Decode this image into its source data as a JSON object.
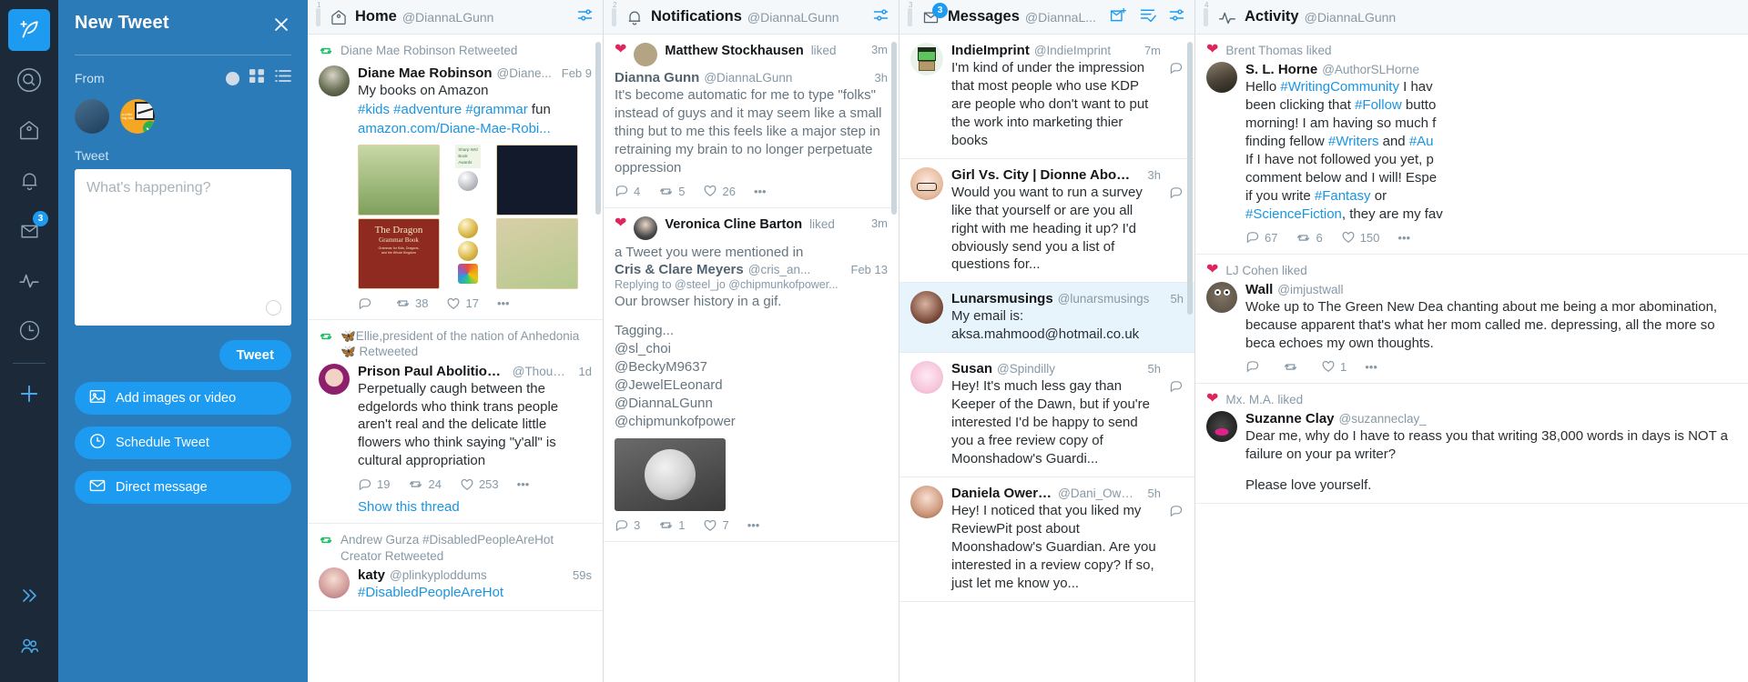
{
  "rail": {
    "items": [
      {
        "name": "compose-tweet",
        "icon": "feather-plus-icon",
        "active": true,
        "badge": ""
      },
      {
        "name": "search",
        "icon": "search-icon",
        "active": false,
        "badge": ""
      },
      {
        "name": "home",
        "icon": "home-icon",
        "active": false,
        "badge": ""
      },
      {
        "name": "notifications",
        "icon": "bell-icon",
        "active": false,
        "badge": ""
      },
      {
        "name": "messages",
        "icon": "envelope-icon",
        "active": false,
        "badge": "3"
      },
      {
        "name": "activity",
        "icon": "activity-pulse-icon",
        "active": false,
        "badge": ""
      },
      {
        "name": "scheduled",
        "icon": "clock-icon",
        "active": false,
        "badge": ""
      },
      {
        "name": "add-column",
        "icon": "plus-icon",
        "active": false,
        "badge": ""
      }
    ],
    "bottom": [
      {
        "name": "collapse-sidebar",
        "icon": "chevron-double-right-icon"
      },
      {
        "name": "accounts",
        "icon": "people-icon"
      }
    ]
  },
  "compose": {
    "title": "New Tweet",
    "close_label": "×",
    "from_label": "From",
    "tweet_label": "Tweet",
    "placeholder": "What's happening?",
    "tweet_button": "Tweet",
    "actions": [
      {
        "label": "Add images or video",
        "icon": "image-icon"
      },
      {
        "label": "Schedule Tweet",
        "icon": "clock-icon"
      },
      {
        "label": "Direct message",
        "icon": "envelope-icon"
      }
    ],
    "accent": "#1d9bf0",
    "panel_bg": "#2b7bb9"
  },
  "columns": [
    {
      "num": "1",
      "title": "Home",
      "handle": "@DiannaLGunn",
      "icon": "home-icon",
      "badge": "",
      "actions": [
        "column-options-icon"
      ],
      "items": [
        {
          "context": "Diane Mae Robinson Retweeted",
          "context_icon": "retweet-icon",
          "name": "Diane Mae Robinson",
          "handle": "@Diane...",
          "time": "Feb 9",
          "avatar": "a-diane",
          "text": "My books on Amazon",
          "link_text": "#kids #adventure #grammar",
          "text_tail": " fun",
          "url": "amazon.com/Diane-Mae-Robi...",
          "media": "book-grid",
          "reply": "",
          "retweet": "38",
          "like": "17",
          "more": "•••"
        },
        {
          "context": "🦋Ellie,president of the nation of Anhedonia 🦋 Retweeted",
          "context_icon": "retweet-icon",
          "name": "Prison Paul Abolitionist",
          "handle": "@Thoug...",
          "time": "1d",
          "avatar": "a-paul",
          "text": "Perpetually caugh between the edgelords who think trans people aren't real and the delicate little flowers who think saying \"y'all\" is cultural appropriation",
          "reply": "19",
          "retweet": "24",
          "like": "253",
          "more": "•••",
          "thread_link": "Show this thread"
        },
        {
          "context": "Andrew Gurza #DisabledPeopleAreHot Creator Retweeted",
          "context_icon": "retweet-icon",
          "name": "katy",
          "handle": "@plinkyploddums",
          "time": "59s",
          "avatar": "a-katy",
          "link_text": "#DisabledPeopleAreHot"
        }
      ]
    },
    {
      "num": "2",
      "title": "Notifications",
      "handle": "@DiannaLGunn",
      "icon": "bell-icon",
      "badge": "",
      "actions": [
        "column-options-icon"
      ],
      "items": [
        {
          "context": "Matthew Stockhausen",
          "context_verb": "liked",
          "context_icon": "heart-icon",
          "context_time": "3m",
          "avatar": "a-matt",
          "name": "Dianna Gunn",
          "handle": "@DiannaLGunn",
          "time": "3h",
          "text": "It's become automatic for me to type \"folks\" instead of guys and it may seem like a small thing but to me this feels like a major step in retraining my brain to no longer perpetuate oppression",
          "reply": "4",
          "retweet": "5",
          "like": "26",
          "more": "•••"
        },
        {
          "context": "Veronica Cline Barton",
          "context_verb": "liked",
          "context_icon": "heart-icon",
          "context_time": "3m",
          "avatar": "a-vero",
          "context_line2": "a Tweet you were mentioned in",
          "name": "Cris & Clare Meyers",
          "handle": "@cris_an...",
          "time": "Feb 13",
          "replying_to": "Replying to @steel_jo @chipmunkofpower...",
          "text": "Our browser history in a gif.",
          "text2": "Tagging...\n@sl_choi\n@BeckyM9637\n@JewelELeonard\n@DiannaLGunn\n@chipmunkofpower",
          "media": "cat-photo",
          "reply": "3",
          "retweet": "1",
          "like": "7",
          "more": "•••"
        }
      ]
    },
    {
      "num": "3",
      "title": "Messages",
      "handle": "@DiannaL...",
      "icon": "envelope-icon",
      "badge": "3",
      "actions": [
        "new-message-icon",
        "mark-all-read-icon",
        "column-options-icon"
      ],
      "items": [
        {
          "name": "IndieImprint",
          "handle": "@IndieImprint",
          "time": "7m",
          "avatar": "a-frank",
          "text": "I'm kind of under the impression that most people who use KDP are people who don't want to put the work into marketing thier books",
          "reply_icon": "reply-icon"
        },
        {
          "name": "Girl Vs. City | Dionne Abouelela...",
          "handle": "",
          "time": "3h",
          "avatar": "a-girl",
          "text": "Would you want to run a survey like that yourself or are you all right with me heading it up? I'd obviously send you a list of questions for...",
          "reply_icon": "reply-icon"
        },
        {
          "name": "Lunarsmusings",
          "handle": "@lunarsmusings",
          "time": "5h",
          "avatar": "a-lunar",
          "text": "My email is: aksa.mahmood@hotmail.co.uk",
          "highlight": true
        },
        {
          "name": "Susan",
          "handle": "@Spindilly",
          "time": "5h",
          "avatar": "a-susan",
          "text": "Hey! It's much less gay than Keeper of the Dawn, but if you're interested I'd be happy to send you a free review copy of Moonshadow's Guardi...",
          "reply_icon": "reply-icon"
        },
        {
          "name": "Daniela Owergoor",
          "handle": "@Dani_Owerg...",
          "time": "5h",
          "avatar": "a-dani",
          "text": "Hey! I noticed that you liked my ReviewPit post about Moonshadow's Guardian. Are you interested in a review copy? If so, just let me know yo...",
          "reply_icon": "reply-icon"
        }
      ]
    },
    {
      "num": "4",
      "title": "Activity",
      "handle": "@DiannaLGunn",
      "icon": "activity-pulse-icon",
      "badge": "",
      "actions": [],
      "items": [
        {
          "context": "Brent Thomas liked",
          "context_icon": "heart-icon",
          "name": "S. L. Horne",
          "handle": "@AuthorSLHorne",
          "avatar": "a-slhorne",
          "text_parts": [
            {
              "t": "Hello ",
              "k": "p"
            },
            {
              "t": "#WritingCommunity",
              "k": "l"
            },
            {
              "t": " I hav",
              "k": "p"
            },
            {
              "t": "\nbeen clicking that ",
              "k": "p"
            },
            {
              "t": "#Follow",
              "k": "l"
            },
            {
              "t": " butto",
              "k": "p"
            },
            {
              "t": "\nmorning! I am having so much f\nfinding fellow ",
              "k": "p"
            },
            {
              "t": "#Writers",
              "k": "l"
            },
            {
              "t": " and ",
              "k": "p"
            },
            {
              "t": "#Au",
              "k": "l"
            },
            {
              "t": "\nIf I have not followed you yet, p\ncomment below and I will! Espe\nif you write ",
              "k": "p"
            },
            {
              "t": "#Fantasy",
              "k": "l"
            },
            {
              "t": " or\n",
              "k": "p"
            },
            {
              "t": "#ScienceFiction",
              "k": "l"
            },
            {
              "t": ", they are my fav",
              "k": "p"
            }
          ],
          "reply": "67",
          "retweet": "6",
          "like": "150",
          "more": "•••"
        },
        {
          "context": "LJ Cohen liked",
          "context_icon": "heart-icon",
          "name": "Wall",
          "handle": "@imjustwall",
          "avatar": "a-wall",
          "text": "Woke up to The Green New Dea chanting about me being a mor abomination, because apparent that's what her mom called me. depressing, all the more so beca echoes my own thoughts.",
          "reply": "",
          "retweet": "",
          "like": "1",
          "more": "•••"
        },
        {
          "context": "Mx. M.A. liked",
          "context_icon": "heart-icon",
          "name": "Suzanne Clay",
          "handle": "@suzanneclay_",
          "avatar": "a-suz",
          "text": "Dear me, why do I have to reass you that writing 38,000 words in days is NOT a failure on your pa writer?",
          "text2": "Please love yourself."
        }
      ]
    }
  ]
}
